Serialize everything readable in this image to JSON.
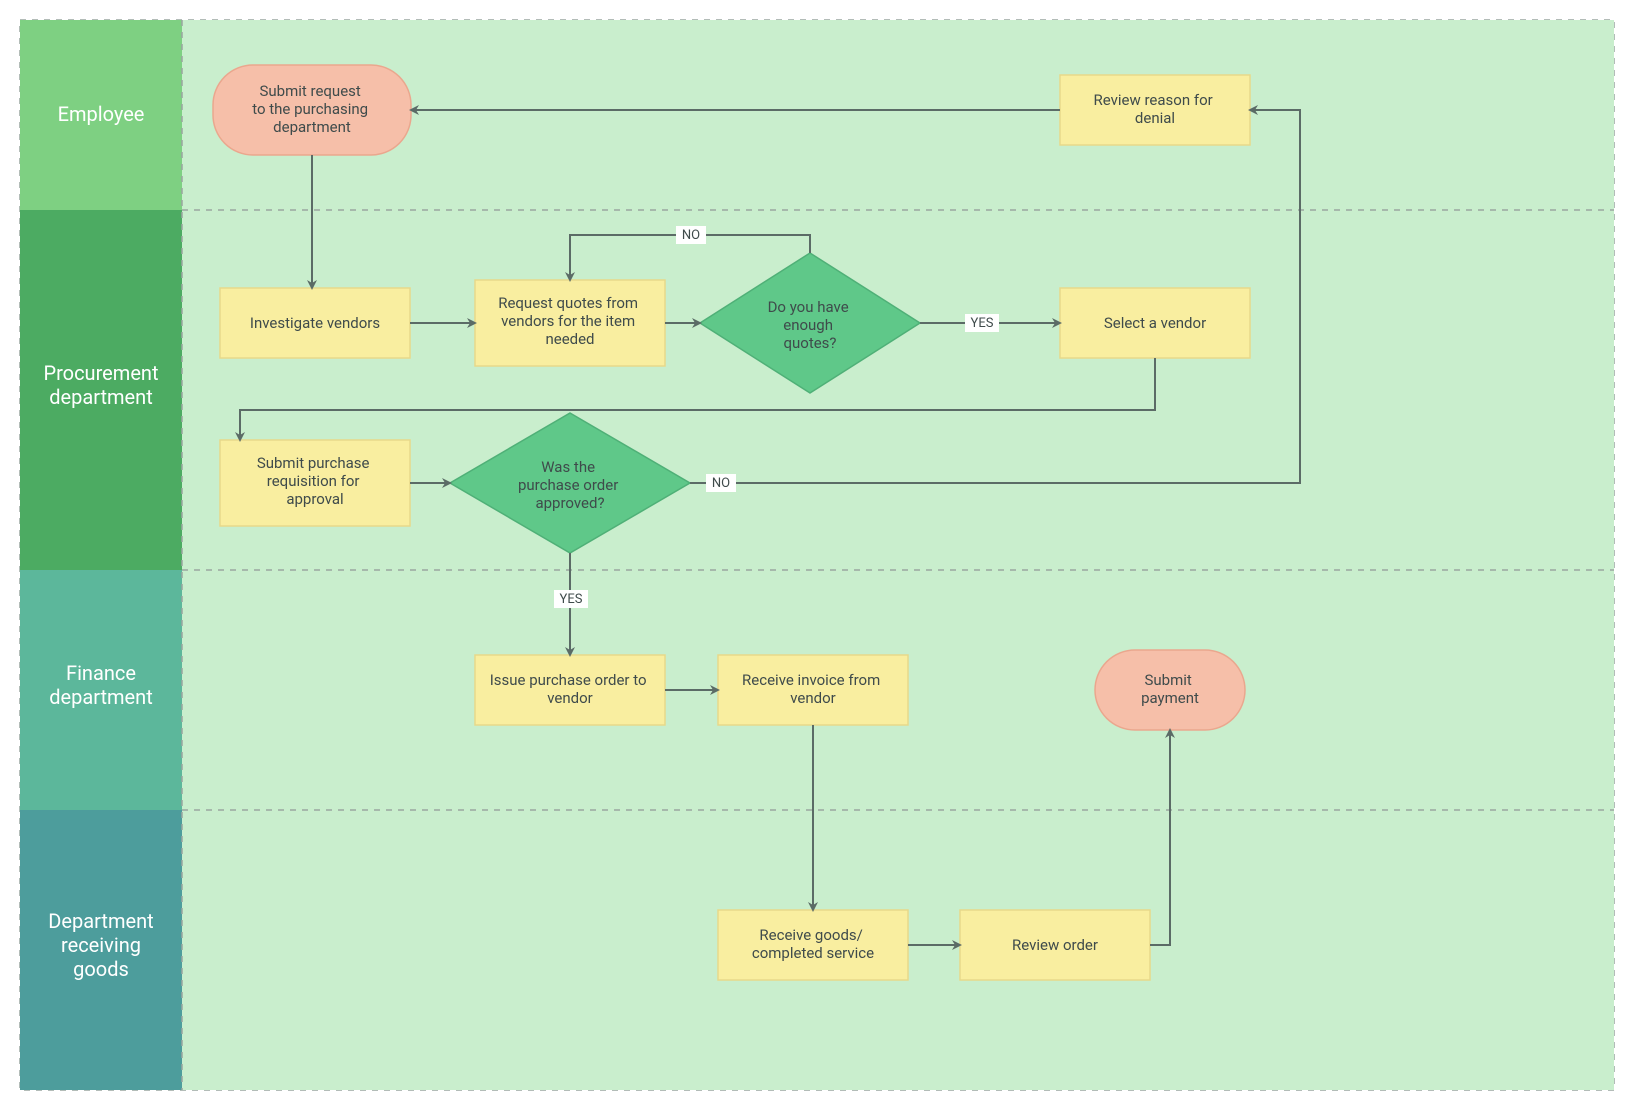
{
  "lanes": {
    "employee": "Employee",
    "procurement": "Procurement department",
    "finance": "Finance department",
    "receiving": "Department receiving goods"
  },
  "nodes": {
    "submitRequest": "Submit request to the purchasing department",
    "reviewDenial": "Review reason for denial",
    "investigate": "Investigate vendors",
    "requestQuotes": "Request quotes from vendors for the item needed",
    "enoughQuotes": "Do you have enough quotes?",
    "selectVendor": "Select a vendor",
    "submitReq": "Submit purchase requisition for approval",
    "approved": "Was the purchase order approved?",
    "issuePO": "Issue purchase order to vendor",
    "receiveInvoice": "Receive invoice from vendor",
    "submitPayment": "Submit payment",
    "receiveGoods": "Receive goods/ completed service",
    "reviewOrder": "Review order"
  },
  "edges": {
    "yes": "YES",
    "no": "NO"
  },
  "colors": {
    "laneBg": "#c9eecd",
    "lane1": "#7ed082",
    "lane2": "#4cab62",
    "lane3": "#5cb79b",
    "lane4": "#4d9d9c",
    "dash": "#9aa6a0",
    "arrow": "#5b6b66",
    "rect": "#f9eea0",
    "rectStroke": "#e7d88a",
    "terminator": "#f6bfa9",
    "terminatorStroke": "#eaa78e",
    "diamond": "#5fc889",
    "diamondStroke": "#4fb077",
    "labelBg": "#ffffff"
  }
}
